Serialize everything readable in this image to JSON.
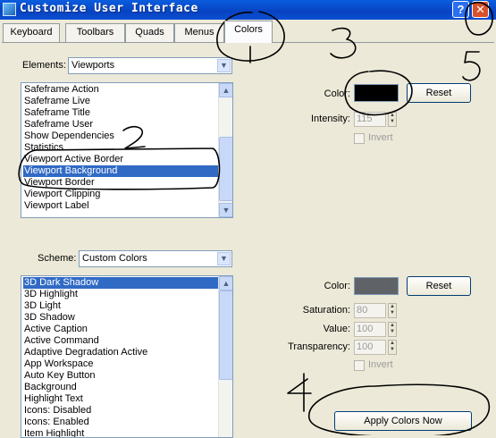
{
  "window": {
    "title": "Customize User Interface",
    "help_glyph": "?",
    "close_glyph": "✕"
  },
  "tabs": [
    {
      "label": "Keyboard"
    },
    {
      "label": "Toolbars"
    },
    {
      "label": "Quads"
    },
    {
      "label": "Menus"
    },
    {
      "label": "Colors",
      "active": true
    }
  ],
  "elements": {
    "label": "Elements:",
    "selected": "Viewports",
    "items": [
      {
        "label": "Safeframe Action"
      },
      {
        "label": "Safeframe Live"
      },
      {
        "label": "Safeframe Title"
      },
      {
        "label": "Safeframe User"
      },
      {
        "label": "Show Dependencies"
      },
      {
        "label": "Statistics"
      },
      {
        "label": "Viewport Active Border"
      },
      {
        "label": "Viewport Background",
        "selected": true
      },
      {
        "label": "Viewport Border"
      },
      {
        "label": "Viewport Clipping"
      },
      {
        "label": "Viewport Label"
      }
    ]
  },
  "element_color": {
    "color_label": "Color:",
    "color_value": "#000000",
    "reset_label": "Reset",
    "intensity_label": "Intensity:",
    "intensity_value": "115",
    "invert_label": "Invert"
  },
  "scheme": {
    "label": "Scheme:",
    "selected": "Custom Colors",
    "items": [
      {
        "label": "3D Dark Shadow",
        "selected": true
      },
      {
        "label": "3D Highlight"
      },
      {
        "label": "3D Light"
      },
      {
        "label": "3D Shadow"
      },
      {
        "label": "Active Caption"
      },
      {
        "label": "Active Command"
      },
      {
        "label": "Adaptive Degradation Active"
      },
      {
        "label": "App Workspace"
      },
      {
        "label": "Auto Key Button"
      },
      {
        "label": "Background"
      },
      {
        "label": "Highlight Text"
      },
      {
        "label": "Icons: Disabled"
      },
      {
        "label": "Icons: Enabled"
      },
      {
        "label": "Item Highlight"
      }
    ]
  },
  "scheme_color": {
    "color_label": "Color:",
    "color_value": "#5f6368",
    "reset_label": "Reset",
    "saturation_label": "Saturation:",
    "saturation_value": "80",
    "value_label": "Value:",
    "value_value": "100",
    "transparency_label": "Transparency:",
    "transparency_value": "100",
    "invert_label": "Invert",
    "apply_label": "Apply Colors Now"
  },
  "colors": {
    "selection": "#316ac5",
    "annotation_ink": "#000000"
  }
}
